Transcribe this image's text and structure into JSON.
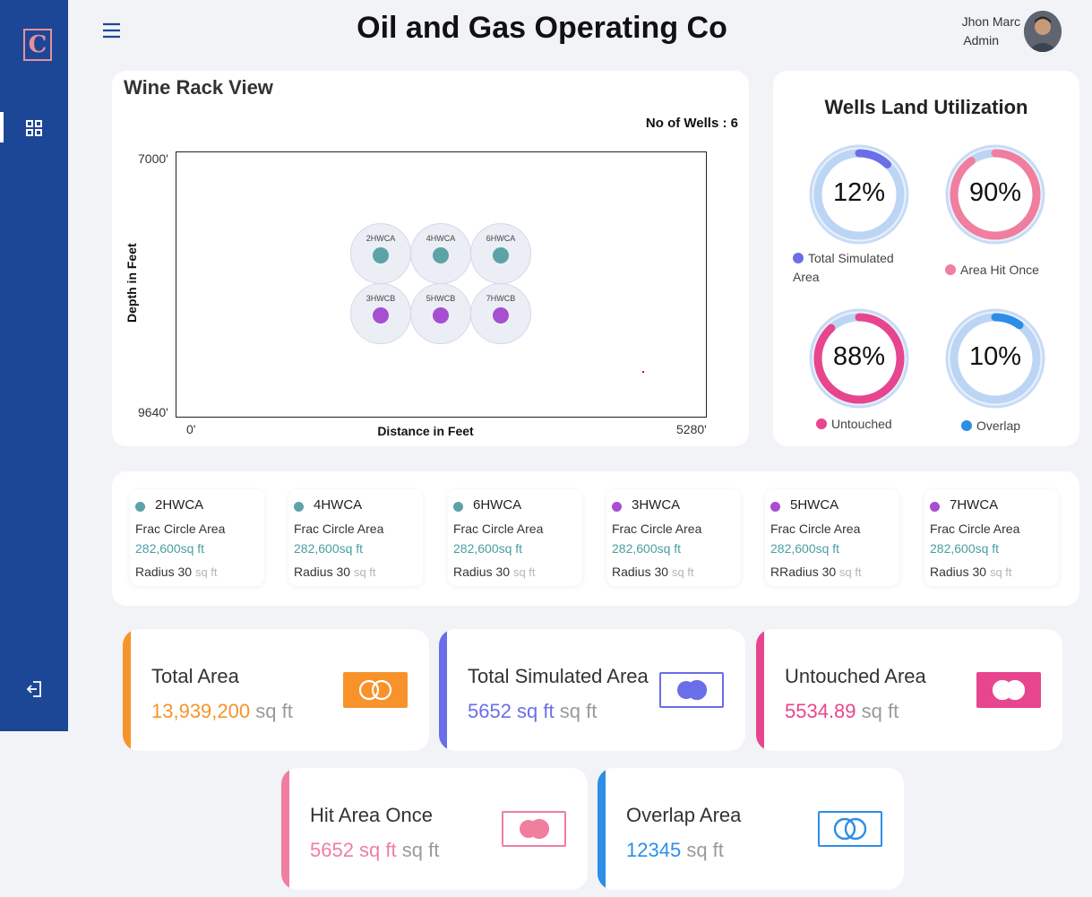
{
  "header": {
    "title": "Oil and Gas Operating Co",
    "user_name": "Jhon Marc",
    "user_role": "Admin"
  },
  "sidebar": {
    "logo_letter": "C",
    "icons": [
      "dashboard-grid-icon",
      "logout-icon"
    ]
  },
  "wine_rack": {
    "title": "Wine Rack View",
    "wells_count": "No of Wells : 6",
    "y_top": "7000'",
    "y_bottom": "9640'",
    "x_left": "0'",
    "x_right": "5280'",
    "xlabel": "Distance in Feet",
    "ylabel": "Depth in Feet",
    "wells": [
      {
        "name": "2HWCA",
        "color": "#5ba3a6"
      },
      {
        "name": "4HWCA",
        "color": "#5ba3a6"
      },
      {
        "name": "6HWCA",
        "color": "#5ba3a6"
      },
      {
        "name": "3HWCB",
        "color": "#a64fd0"
      },
      {
        "name": "5HWCB",
        "color": "#a64fd0"
      },
      {
        "name": "7HWCB",
        "color": "#a64fd0"
      }
    ]
  },
  "utilization": {
    "title": "Wells Land Utilization",
    "gauges": [
      {
        "value": "12%",
        "fraction": 0.12,
        "label": "Total Simulated Area",
        "color": "#6a6ee8"
      },
      {
        "value": "90%",
        "fraction": 0.9,
        "label": "Area Hit Once",
        "color": "#f07e9f"
      },
      {
        "value": "88%",
        "fraction": 0.88,
        "label": "Untouched",
        "color": "#e8458f"
      },
      {
        "value": "10%",
        "fraction": 0.1,
        "label": "Overlap",
        "color": "#2c8ee6"
      }
    ]
  },
  "well_details": [
    {
      "name": "2HWCA",
      "color": "#5ba3a6",
      "area_label": "Frac Circle Area",
      "area": "282,600sq ft",
      "radius_label": "Radius 30",
      "radius_unit": "sq ft"
    },
    {
      "name": "4HWCA",
      "color": "#5ba3a6",
      "area_label": "Frac Circle Area",
      "area": "282,600sq ft",
      "radius_label": "Radius 30",
      "radius_unit": "sq ft"
    },
    {
      "name": "6HWCA",
      "color": "#5ba3a6",
      "area_label": "Frac Circle Area",
      "area": "282,600sq ft",
      "radius_label": "Radius 30",
      "radius_unit": "sq ft"
    },
    {
      "name": "3HWCA",
      "color": "#a64fd0",
      "area_label": "Frac Circle Area",
      "area": "282,600sq ft",
      "radius_label": "Radius 30",
      "radius_unit": "sq ft"
    },
    {
      "name": "5HWCA",
      "color": "#a64fd0",
      "area_label": "Frac Circle Area",
      "area": "282,600sq ft",
      "radius_label": "RRadius 30",
      "radius_unit": "sq ft"
    },
    {
      "name": "7HWCA",
      "color": "#a64fd0",
      "area_label": "Frac Circle Area",
      "area": "282,600sq ft",
      "radius_label": "Radius 30",
      "radius_unit": "sq ft"
    }
  ],
  "stats": [
    {
      "label": "Total Area",
      "value": "13,939,200",
      "unit": "sq ft",
      "color": "#f7932a",
      "icon": "two-rings-icon"
    },
    {
      "label": "Total Simulated Area",
      "value": "5652 sq ft",
      "unit": "sq ft",
      "color": "#6a6ee8",
      "icon": "two-rings-icon"
    },
    {
      "label": "Untouched Area",
      "value": "5534.89",
      "unit": "sq ft",
      "color": "#e8458f",
      "icon": "two-rings-icon"
    },
    {
      "label": "Hit Area Once",
      "value": "5652 sq ft",
      "unit": "sq ft",
      "color": "#f07e9f",
      "icon": "two-rings-icon"
    },
    {
      "label": "Overlap Area",
      "value": "12345",
      "unit": "sq ft",
      "color": "#2c8ee6",
      "icon": "two-rings-icon"
    }
  ]
}
